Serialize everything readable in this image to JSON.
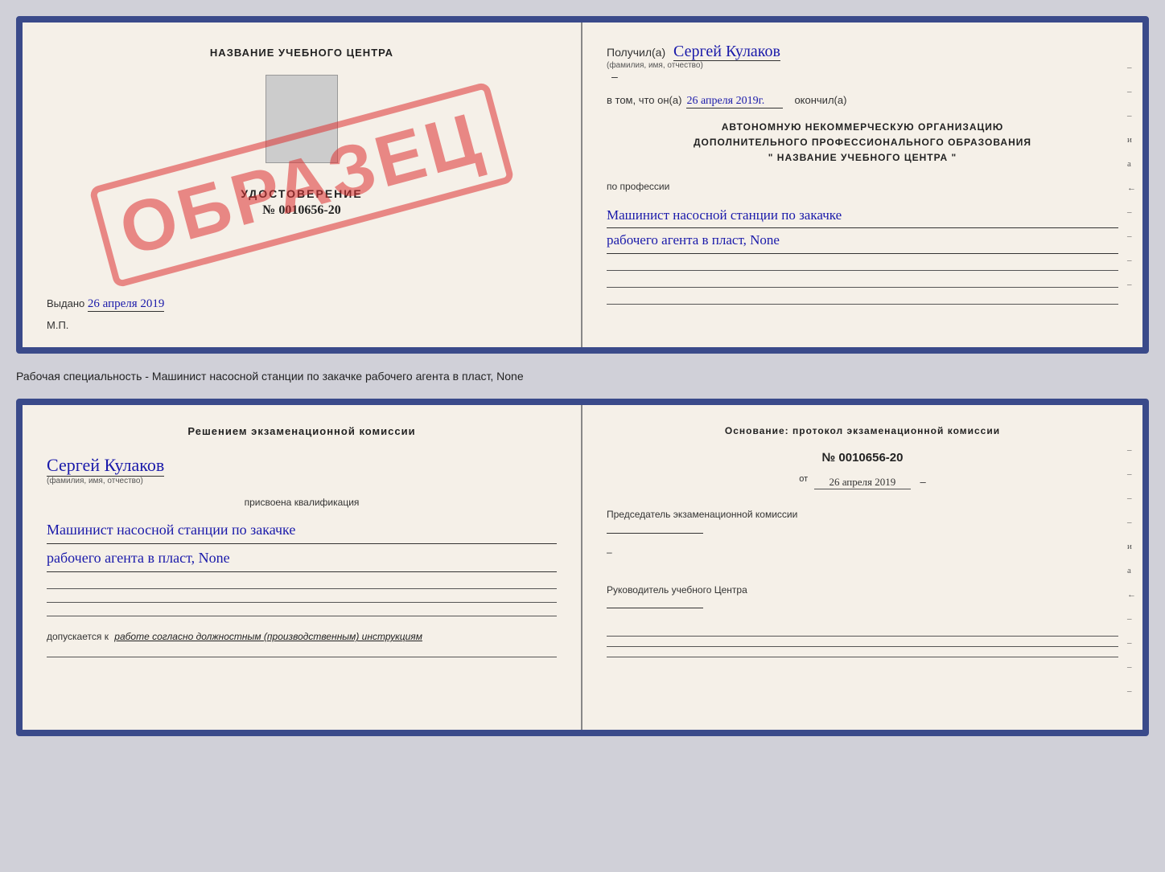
{
  "page": {
    "bg_color": "#d0d0d8"
  },
  "top_cert": {
    "left": {
      "title": "НАЗВАНИЕ УЧЕБНОГО ЦЕНТРА",
      "stamp_text": "ОБРАЗЕЦ",
      "udost_title": "УДОСТОВЕРЕНИЕ",
      "udost_number": "№ 0010656-20",
      "vydano_label": "Выдано",
      "vydano_date": "26 апреля 2019",
      "mp_label": "М.П."
    },
    "right": {
      "poluchil_label": "Получил(а)",
      "poluchil_name": "Сергей Кулаков",
      "fio_hint": "(фамилия, имя, отчество)",
      "vtom_label": "в том, что он(а)",
      "vtom_date": "26 апреля 2019г.",
      "okonchil_label": "окончил(а)",
      "org_line1": "АВТОНОМНУЮ НЕКОММЕРЧЕСКУЮ ОРГАНИЗАЦИЮ",
      "org_line2": "ДОПОЛНИТЕЛЬНОГО ПРОФЕССИОНАЛЬНОГО ОБРАЗОВАНИЯ",
      "org_line3": "\"  НАЗВАНИЕ УЧЕБНОГО ЦЕНТРА  \"",
      "po_professii_label": "по профессии",
      "prof_line1": "Машинист насосной станции по закачке",
      "prof_line2": "рабочего агента в пласт, None"
    }
  },
  "subtitle": "Рабочая специальность - Машинист насосной станции по закачке рабочего агента в пласт, None",
  "bottom_cert": {
    "left": {
      "resheniem_label": "Решением экзаменационной комиссии",
      "name_handwritten": "Сергей Кулаков",
      "fio_hint": "(фамилия, имя, отчество)",
      "prisvoena_label": "присвоена квалификация",
      "prof_line1": "Машинист насосной станции по закачке",
      "prof_line2": "рабочего агента в пласт, None",
      "dopuskaetsya_prefix": "допускается к",
      "dopuskaetsya_text": "работе согласно должностным (производственным) инструкциям"
    },
    "right": {
      "osnov_label": "Основание: протокол экзаменационной комиссии",
      "protocol_number": "№  0010656-20",
      "ot_prefix": "от",
      "ot_date": "26 апреля 2019",
      "pred_label": "Председатель экзаменационной комиссии",
      "ruk_label": "Руководитель учебного Центра"
    }
  },
  "right_marks": {
    "marks": [
      "–",
      "–",
      "–",
      "и",
      "а",
      "←",
      "–",
      "–",
      "–",
      "–"
    ]
  }
}
